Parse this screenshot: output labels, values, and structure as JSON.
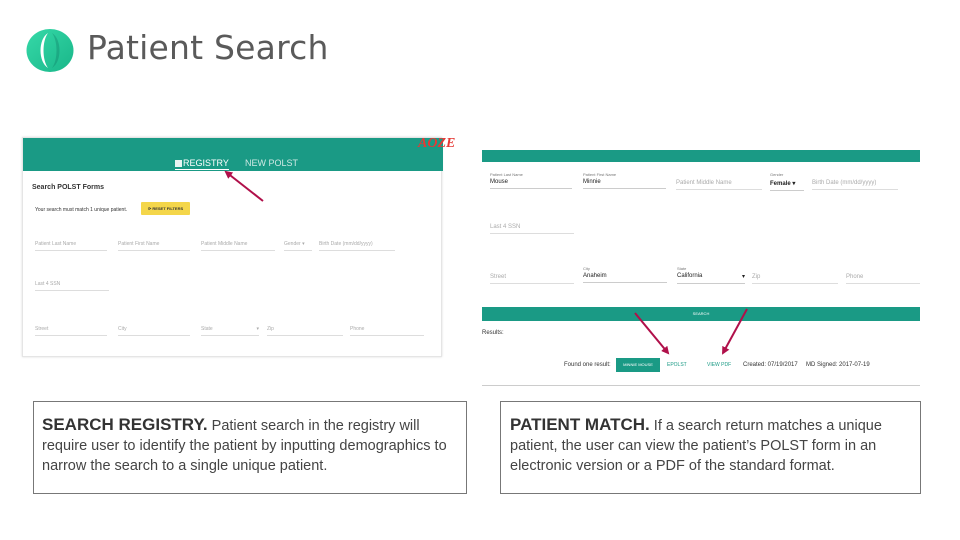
{
  "slide": {
    "title": "Patient Search",
    "logo_icon": "app-logo-icon"
  },
  "left_screenshot": {
    "logo_fragment": "AOZE",
    "tabs": [
      {
        "label": "REGISTRY",
        "icon": "grid-icon",
        "active": true
      },
      {
        "label": "NEW POLST",
        "active": false
      }
    ],
    "heading": "Search POLST Forms",
    "message": "Your search must match 1 unique patient.",
    "reset_button": "RESET FILTERS",
    "fields_row1": [
      "Patient Last Name",
      "Patient First Name",
      "Patient Middle Name",
      "Gender",
      "Birth Date (mm/dd/yyyy)"
    ],
    "field_ssn": "Last 4 SSN",
    "fields_row3": [
      "Street",
      "City",
      "State",
      "Zip",
      "Phone"
    ]
  },
  "right_screenshot": {
    "fields": {
      "last_name_label": "Patient Last Name",
      "last_name_value": "Mouse",
      "first_name_label": "Patient First Name",
      "first_name_value": "Minnie",
      "middle_name_placeholder": "Patient Middle Name",
      "gender_label": "Gender",
      "gender_value": "Female",
      "birth_date_placeholder": "Birth Date (mm/dd/yyyy)",
      "ssn_placeholder": "Last 4 SSN",
      "street_placeholder": "Street",
      "city_label": "City",
      "city_value": "Anaheim",
      "state_label": "State",
      "state_value": "California",
      "zip_placeholder": "Zip",
      "phone_placeholder": "Phone"
    },
    "search_button": "SEARCH",
    "results_label": "Results:",
    "found_text": "Found one result:",
    "patient_button": "MINNIE MOUSE",
    "epolst_link": "EPOLST",
    "viewpdf_link": "VIEW PDF",
    "created": "Created: 07/19/2017",
    "md_signed": "MD Signed: 2017-07-19"
  },
  "captions": {
    "left_heading": "SEARCH REGISTRY.",
    "left_body": " Patient search in the registry will require user to identify the patient by inputting demographics to narrow the search to a single unique patient.",
    "right_heading": "PATIENT MATCH.",
    "right_body": " If a search return matches a unique patient,  the user can view the patient’s POLST form in an electronic  version or a PDF of the standard format."
  },
  "colors": {
    "teal": "#1a9a85",
    "logo_green": "#2bd1a0",
    "arrow": "#b0104a",
    "reset_yellow": "#f4d64a"
  }
}
